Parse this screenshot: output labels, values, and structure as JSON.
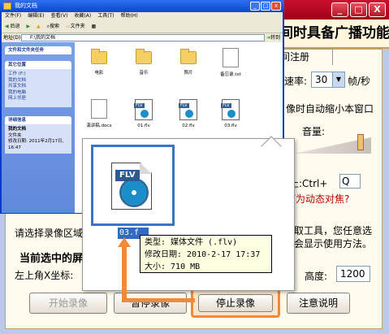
{
  "recorder": {
    "banner": "间时具备广播功能！",
    "tab_label": "间注册",
    "rate_label": "速率:",
    "rate_value": "30",
    "rate_unit": "帧/秒",
    "minimize_text": "像时自动缩小本窗口",
    "volume_label": "音量:",
    "hotkey_label": "停止:Ctrl+",
    "hotkey_value": "Q",
    "help_link": "可为动态对焦?",
    "region_label": "请选择录像区域",
    "tool_hint_1": "选取工具，您任意选",
    "tool_hint_2": "止会显示使用方法。",
    "group_title": "当前选中的屏",
    "x_label": "左上角X坐标:",
    "height_label": "高度:",
    "height_value": "1200",
    "buttons": {
      "start": "开始录像",
      "pause": "暂停录像",
      "stop": "停止录像",
      "help": "注意说明"
    },
    "window_buttons": {
      "minimize": "_",
      "maximize": "□",
      "close": "X"
    }
  },
  "explorer": {
    "title": "我的文档",
    "menu": [
      "文件(F)",
      "编辑(E)",
      "查看(V)",
      "收藏(A)",
      "工具(T)",
      "帮助(H)"
    ],
    "toolbar": {
      "back": "后退",
      "search": "搜索",
      "folders": "文件夹"
    },
    "address_label": "地址(D)",
    "address_value": "F:\\我的文档",
    "go_label": "转到",
    "panels": {
      "tasks_title": "文件和文件夹任务",
      "places_title": "其它位置",
      "places": [
        "工作 (F:)",
        "我的文档",
        "共享文档",
        "我的电脑",
        "网上邻居"
      ],
      "details_title": "详细信息",
      "details_name": "我的文档",
      "details_type": "文件夹",
      "details_modified": "修改日期: 2011年2月17日, 16:47"
    },
    "files": [
      {
        "name": "电影",
        "kind": "folder"
      },
      {
        "name": "音乐",
        "kind": "folder"
      },
      {
        "name": "照片",
        "kind": "folder"
      },
      {
        "name": "备忘录.txt",
        "kind": "doc"
      },
      {
        "name": "演讲稿.docx",
        "kind": "doc"
      },
      {
        "name": "01.flv",
        "kind": "flv"
      },
      {
        "name": "02.flv",
        "kind": "flv"
      },
      {
        "name": "03.flv",
        "kind": "flv"
      }
    ]
  },
  "zoom": {
    "flv_tag": "FLV",
    "filename": "03.f",
    "tooltip": {
      "type": "类型: 媒体文件 (.flv)",
      "modified": "修改日期: 2010-2-17 17:37",
      "size": "大小: 710 MB"
    }
  },
  "colors": {
    "accent_red": "#c8102e",
    "highlight_orange": "#f08a38",
    "xp_blue": "#0a46d0"
  }
}
